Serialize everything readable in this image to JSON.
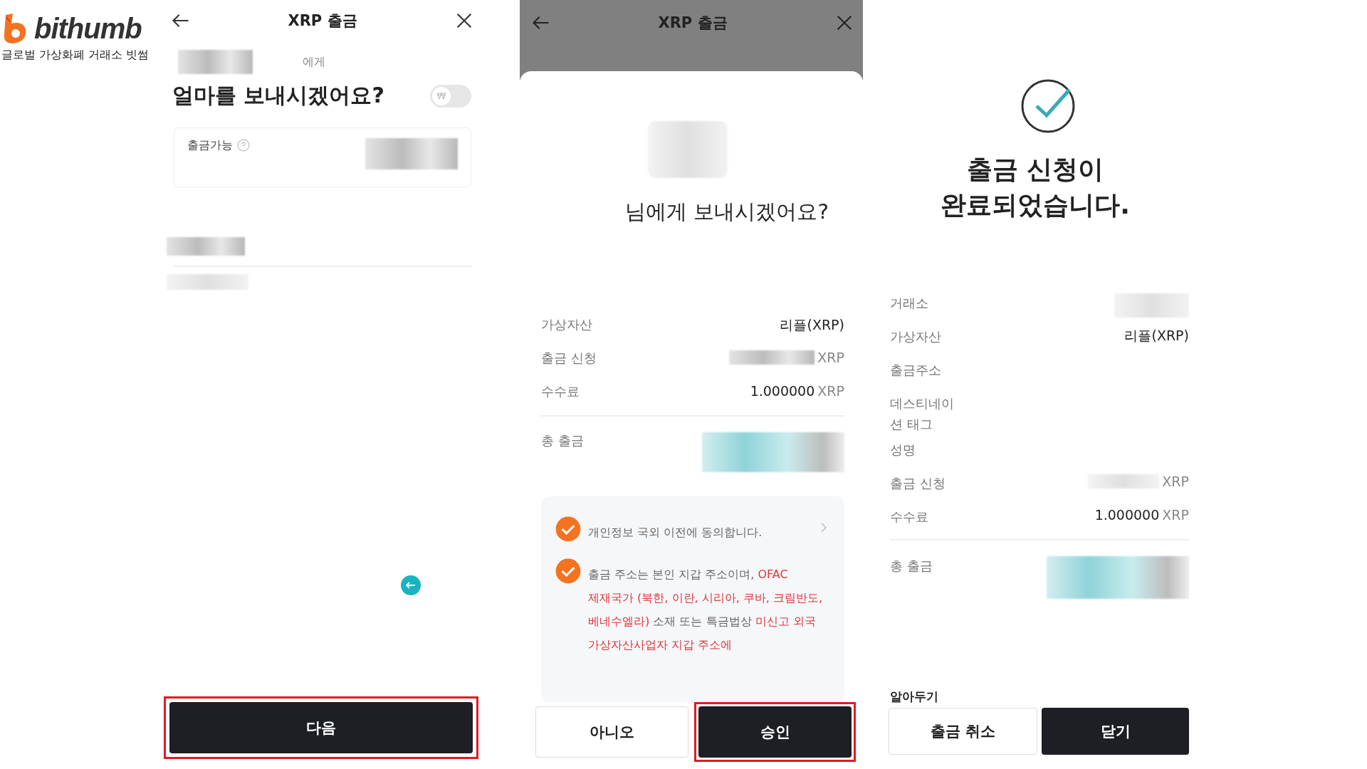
{
  "logo": {
    "wordmark": "bithumb",
    "tagline": "글로벌 가상화폐 거래소 빗썸"
  },
  "amount_screen": {
    "title": "XRP 출금",
    "recipient_suffix": "에게",
    "heading": "얼마를 보내시겠어요?",
    "currency_toggle": {
      "symbol": "₩",
      "on": false
    },
    "available": {
      "label": "출금가능"
    },
    "next_button": {
      "label": "다음",
      "highlighted": true
    }
  },
  "confirm_screen": {
    "title": "XRP 출금",
    "question": "님에게 보내시겠어요?",
    "details": [
      {
        "label": "가상자산",
        "kind": "text",
        "value": "리플(XRP)",
        "divider_before": false
      },
      {
        "label": "출금 신청",
        "kind": "redacted_unit",
        "unit": "XRP",
        "divider_before": false
      },
      {
        "label": "수수료",
        "kind": "amount",
        "value": "1.000000",
        "unit": "XRP",
        "divider_before": false
      },
      {
        "label": "총 출금",
        "kind": "redacted",
        "divider_before": true
      }
    ],
    "consents": [
      {
        "checked": true,
        "has_arrow": true,
        "segments": [
          {
            "kind": "normal",
            "text": "개인정보 국외 이전에 동의합니다."
          }
        ]
      },
      {
        "checked": true,
        "has_arrow": false,
        "segments": [
          {
            "kind": "normal",
            "text": "출금 주소는 본인 지갑 주소이며, "
          },
          {
            "kind": "warning",
            "text": "OFAC 제재국가 (북한, 이란, 시리아, 쿠바, 크림반도, 베네수엘라)"
          },
          {
            "kind": "normal",
            "text": " 소재 또는 특금법상 "
          },
          {
            "kind": "warning",
            "text": "미신고 외국 가상자산사업자 지갑 주소에"
          }
        ]
      }
    ],
    "buttons": [
      {
        "label": "아니오",
        "kind": "secondary",
        "highlighted": false
      },
      {
        "label": "승인",
        "kind": "primary",
        "highlighted": true
      }
    ]
  },
  "done_screen": {
    "title": "출금 신청이 완료되었습니다.",
    "details": [
      {
        "label": "거래소",
        "kind": "redacted_light",
        "divider_before": false
      },
      {
        "label": "가상자산",
        "kind": "text",
        "value": "리플(XRP)",
        "divider_before": false
      },
      {
        "label": "출금주소",
        "kind": "empty",
        "divider_before": false
      },
      {
        "label": "데스티네이션 태그",
        "kind": "empty",
        "divider_before": false
      },
      {
        "label": "성명",
        "kind": "empty",
        "divider_before": false
      },
      {
        "label": "출금 신청",
        "kind": "redacted_unit",
        "unit": "XRP",
        "divider_before": false
      },
      {
        "label": "수수료",
        "kind": "amount",
        "value": "1.000000",
        "unit": "XRP",
        "divider_before": false
      },
      {
        "label": "총 출금",
        "kind": "redacted",
        "divider_before": true
      }
    ],
    "notice_heading": "알아두기",
    "buttons": [
      {
        "label": "출금 취소",
        "kind": "secondary"
      },
      {
        "label": "닫기",
        "kind": "primary"
      }
    ]
  }
}
